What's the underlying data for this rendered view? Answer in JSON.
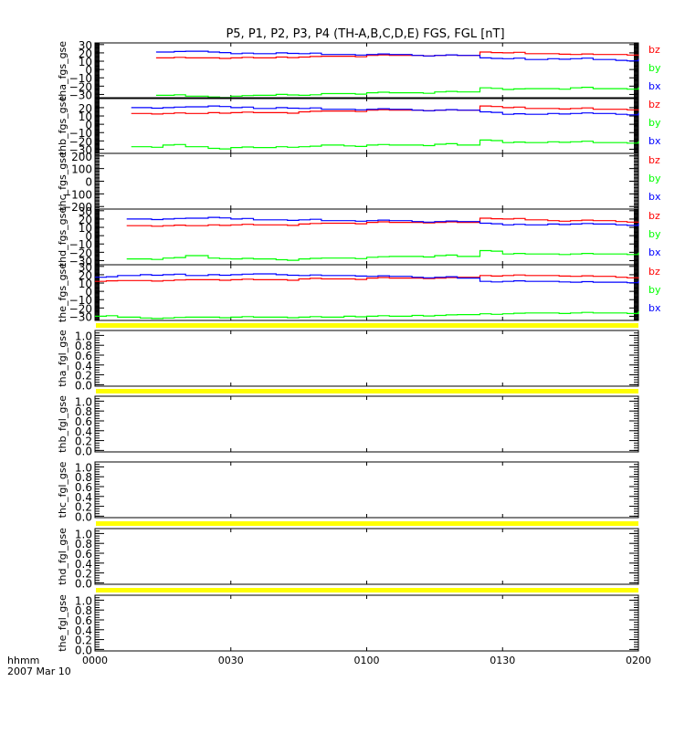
{
  "chart_data": {
    "type": "line",
    "title": "P5, P1, P2, P3, P4 (TH-A,B,C,D,E) FGS, FGL [nT]",
    "x_axis": {
      "unit_label": "hhmm",
      "date_label": "2007 Mar 10",
      "range_minutes": [
        0,
        120
      ],
      "tick_labels": [
        "0000",
        "0030",
        "0100",
        "0130",
        "0200"
      ],
      "tick_minutes": [
        0,
        30,
        60,
        90,
        120
      ]
    },
    "sample_minutes": [
      0,
      5,
      10,
      15,
      20,
      25,
      30,
      35,
      40,
      45,
      50,
      55,
      60,
      65,
      70,
      75,
      80,
      85,
      90,
      95,
      100,
      105,
      110,
      115,
      120
    ],
    "legend": [
      {
        "name": "bz",
        "color": "#ff0000"
      },
      {
        "name": "by",
        "color": "#00ff00"
      },
      {
        "name": "bx",
        "color": "#0000ff"
      }
    ],
    "panels": [
      {
        "ylabel": "tha_fgs_gse",
        "ylim": [
          -35,
          32
        ],
        "ticks": [
          30,
          20,
          10,
          0,
          -10,
          -20,
          -30
        ],
        "tick_labels": [
          "30",
          "20",
          "10",
          "0",
          "−10",
          "−20",
          "−30"
        ],
        "minor_step": 1,
        "show_legend": true,
        "series": {
          "bz": [
            null,
            null,
            null,
            14,
            14,
            14,
            14,
            14,
            15,
            15,
            16,
            16,
            17,
            17,
            17,
            17,
            17,
            21,
            20,
            19,
            19,
            18,
            18,
            18,
            17
          ],
          "by": [
            null,
            null,
            null,
            -31,
            -32,
            -33,
            -32,
            -31,
            -30,
            -31,
            -29,
            -29,
            -28,
            -28,
            -28,
            -27,
            -27,
            -22,
            -24,
            -23,
            -23,
            -22,
            -23,
            -23,
            -22
          ],
          "bx": [
            null,
            null,
            null,
            21,
            22,
            21,
            19,
            19,
            20,
            19,
            18,
            18,
            18,
            18,
            17,
            17,
            17,
            14,
            13,
            12,
            13,
            13,
            12,
            11,
            12
          ]
        },
        "start_minute": 13.5
      },
      {
        "ylabel": "thb_fgs_gse",
        "ylim": [
          -35,
          32
        ],
        "ticks": [
          20,
          10,
          0,
          -10,
          -20,
          -30
        ],
        "tick_labels": [
          "20",
          "10",
          "0",
          "−10",
          "−20",
          "−30"
        ],
        "minor_step": 1,
        "show_legend": true,
        "series": {
          "bz": [
            null,
            null,
            13,
            13,
            13,
            14,
            14,
            14,
            14,
            15,
            16,
            16,
            17,
            17,
            17,
            17,
            17,
            22,
            20,
            19,
            19,
            19,
            18,
            18,
            17
          ],
          "by": [
            null,
            null,
            -27,
            -25,
            -27,
            -29,
            -28,
            -28,
            -27,
            -27,
            -25,
            -26,
            -25,
            -25,
            -25,
            -24,
            -25,
            -19,
            -22,
            -22,
            -21,
            -21,
            -22,
            -22,
            -21
          ],
          "bx": [
            null,
            null,
            20,
            20,
            21,
            22,
            20,
            19,
            20,
            19,
            18,
            18,
            18,
            18,
            17,
            17,
            17,
            15,
            12,
            12,
            13,
            13,
            13,
            12,
            13
          ]
        },
        "start_minute": 8
      },
      {
        "ylabel": "thc_fgs_gse",
        "ylim": [
          -220,
          220
        ],
        "ticks": [
          200,
          100,
          0,
          -100,
          -200
        ],
        "tick_labels": [
          "200",
          "100",
          "0",
          "−100",
          "−200"
        ],
        "minor_step": 10,
        "show_legend": true,
        "series": {
          "bz": [],
          "by": [],
          "bx": []
        }
      },
      {
        "ylabel": "thd_fgs_gse",
        "ylim": [
          -35,
          32
        ],
        "ticks": [
          30,
          20,
          10,
          0,
          -10,
          -20,
          -30
        ],
        "tick_labels": [
          "30",
          "20",
          "10",
          "0",
          "−10",
          "−20",
          "−30"
        ],
        "minor_step": 1,
        "show_legend": true,
        "series": {
          "bz": [
            null,
            null,
            12,
            12,
            12,
            13,
            13,
            13,
            13,
            14,
            15,
            15,
            16,
            16,
            16,
            16,
            16,
            21,
            20,
            19,
            18,
            18,
            18,
            17,
            16
          ],
          "by": [
            null,
            null,
            -28,
            -27,
            -24,
            -27,
            -28,
            -28,
            -29,
            -28,
            -27,
            -27,
            -26,
            -25,
            -25,
            -24,
            -25,
            -18,
            -22,
            -22,
            -22,
            -22,
            -22,
            -22,
            -21
          ],
          "bx": [
            null,
            null,
            20,
            20,
            21,
            22,
            20,
            19,
            19,
            19,
            18,
            18,
            18,
            18,
            17,
            17,
            17,
            15,
            13,
            13,
            14,
            14,
            14,
            13,
            14
          ]
        },
        "start_minute": 7
      },
      {
        "ylabel": "the_fgs_gse",
        "ylim": [
          -35,
          32
        ],
        "ticks": [
          30,
          20,
          10,
          0,
          -10,
          -20,
          -30
        ],
        "tick_labels": [
          "30",
          "20",
          "10",
          "0",
          "−10",
          "−20",
          "−30"
        ],
        "minor_step": 1,
        "show_legend": true,
        "series": {
          "bz": [
            12,
            13,
            13,
            13,
            14,
            14,
            14,
            14,
            14,
            15,
            15,
            15,
            16,
            16,
            16,
            16,
            17,
            19,
            19,
            19,
            19,
            18,
            18,
            17,
            16
          ],
          "by": [
            -30,
            -31,
            -32,
            -32,
            -31,
            -31,
            -31,
            -31,
            -31,
            -31,
            -31,
            -30,
            -30,
            -30,
            -29,
            -29,
            -28,
            -27,
            -27,
            -26,
            -26,
            -26,
            -26,
            -26,
            -25
          ],
          "bx": [
            17,
            19,
            20,
            20,
            19,
            20,
            20,
            21,
            20,
            19,
            19,
            19,
            18,
            18,
            17,
            17,
            16,
            12,
            12,
            12,
            12,
            11,
            11,
            11,
            12
          ]
        },
        "start_minute": 0
      },
      {
        "ylabel": "tha_fgl_gse",
        "ylim": [
          -0.03,
          1.1
        ],
        "ticks": [
          1.0,
          0.8,
          0.6,
          0.4,
          0.2,
          0.0
        ],
        "tick_labels": [
          "1.0",
          "0.8",
          "0.6",
          "0.4",
          "0.2",
          "0.0"
        ],
        "minor_step": 0.05,
        "flag_bar": true,
        "show_legend": false,
        "series": {}
      },
      {
        "ylabel": "thb_fgl_gse",
        "ylim": [
          -0.03,
          1.1
        ],
        "ticks": [
          1.0,
          0.8,
          0.6,
          0.4,
          0.2,
          0.0
        ],
        "tick_labels": [
          "1.0",
          "0.8",
          "0.6",
          "0.4",
          "0.2",
          "0.0"
        ],
        "minor_step": 0.05,
        "flag_bar": true,
        "show_legend": false,
        "series": {}
      },
      {
        "ylabel": "thc_fgl_gse",
        "ylim": [
          -0.03,
          1.1
        ],
        "ticks": [
          1.0,
          0.8,
          0.6,
          0.4,
          0.2,
          0.0
        ],
        "tick_labels": [
          "1.0",
          "0.8",
          "0.6",
          "0.4",
          "0.2",
          "0.0"
        ],
        "minor_step": 0.05,
        "flag_bar": false,
        "show_legend": false,
        "series": {}
      },
      {
        "ylabel": "thd_fgl_gse",
        "ylim": [
          -0.03,
          1.1
        ],
        "ticks": [
          1.0,
          0.8,
          0.6,
          0.4,
          0.2,
          0.0
        ],
        "tick_labels": [
          "1.0",
          "0.8",
          "0.6",
          "0.4",
          "0.2",
          "0.0"
        ],
        "minor_step": 0.05,
        "flag_bar": true,
        "show_legend": false,
        "series": {}
      },
      {
        "ylabel": "the_fgl_gse",
        "ylim": [
          -0.03,
          1.1
        ],
        "ticks": [
          1.0,
          0.8,
          0.6,
          0.4,
          0.2,
          0.0
        ],
        "tick_labels": [
          "1.0",
          "0.8",
          "0.6",
          "0.4",
          "0.2",
          "0.0"
        ],
        "minor_step": 0.05,
        "flag_bar": true,
        "show_legend": false,
        "series": {}
      }
    ],
    "flag_bar_color": "#ffff00",
    "grid": false
  }
}
